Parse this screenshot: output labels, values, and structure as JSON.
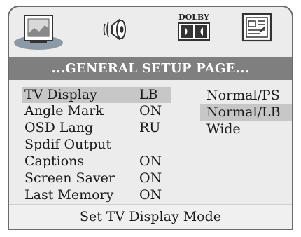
{
  "icons": {
    "general": "general-setup-icon",
    "audio": "speaker-audio-icon",
    "dolby": "dolby-digital-icon",
    "preference": "preference-icon",
    "dolby_text": "DOLBY"
  },
  "header": {
    "title": "...GENERAL SETUP PAGE..."
  },
  "menu": {
    "items": [
      {
        "label": "TV Display",
        "value": "LB"
      },
      {
        "label": "Angle Mark",
        "value": "ON"
      },
      {
        "label": "OSD Lang",
        "value": "RU"
      },
      {
        "label": "Spdif Output",
        "value": ""
      },
      {
        "label": "Captions",
        "value": "ON"
      },
      {
        "label": "Screen Saver",
        "value": "ON"
      },
      {
        "label": "Last Memory",
        "value": "ON"
      }
    ]
  },
  "options": {
    "items": [
      {
        "label": "Normal/PS"
      },
      {
        "label": "Normal/LB"
      },
      {
        "label": "Wide"
      }
    ]
  },
  "footer": {
    "hint": "Set TV Display Mode"
  },
  "colors": {
    "panel": "#ececec",
    "header_bar": "#7f7f7f",
    "highlight": "#c7c7c7",
    "selected_tab": "#8c9aa7"
  }
}
